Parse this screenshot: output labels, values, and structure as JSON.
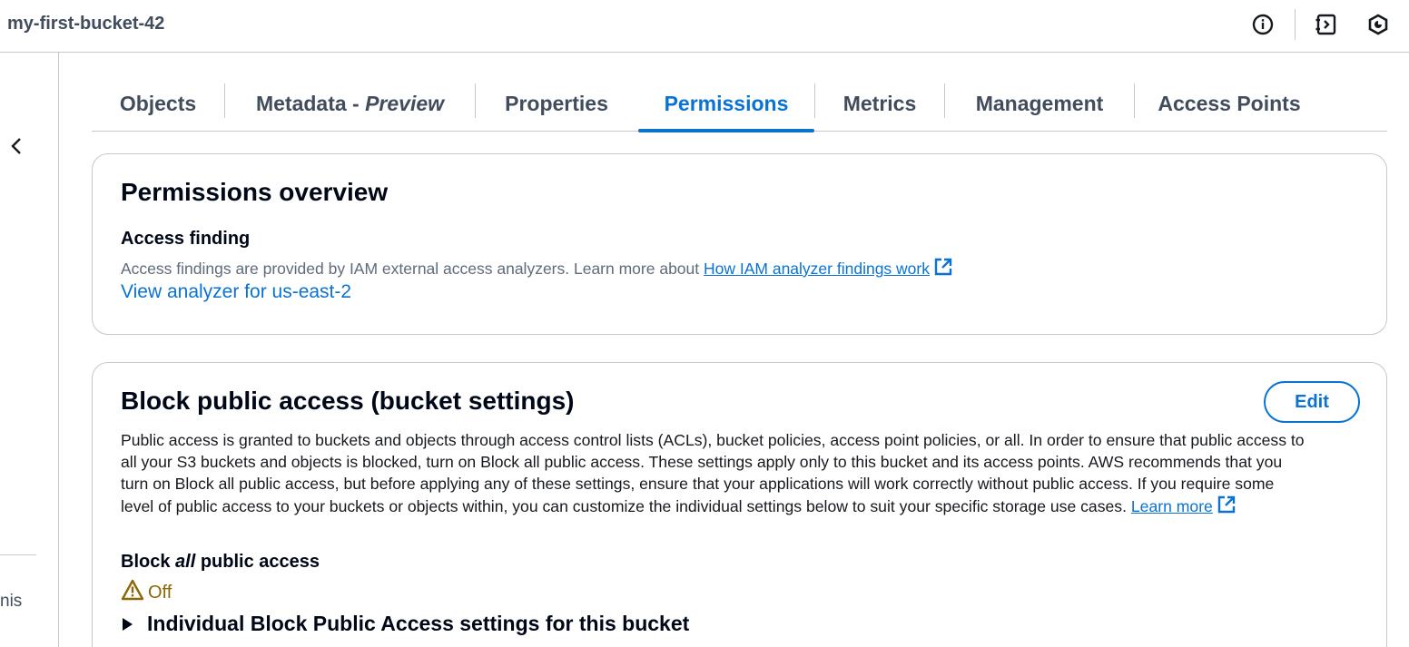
{
  "header": {
    "bucket_name": "my-first-bucket-42",
    "icons": [
      "info-icon",
      "notes-panel-icon",
      "security-shield-icon"
    ]
  },
  "sidebar": {
    "peek_text": "nis"
  },
  "tabs": [
    {
      "label": "Objects"
    },
    {
      "label": "Metadata - ",
      "label_italic": "Preview"
    },
    {
      "label": "Properties"
    },
    {
      "label": "Permissions",
      "active": true
    },
    {
      "label": "Metrics"
    },
    {
      "label": "Management"
    },
    {
      "label": "Access Points"
    }
  ],
  "overview": {
    "title": "Permissions overview",
    "access_finding_label": "Access finding",
    "description": "Access findings are provided by IAM external access analyzers. Learn more about ",
    "link_text": "How IAM analyzer findings work",
    "analyzer_link": "View analyzer for us-east-2"
  },
  "block_public_access": {
    "title": "Block public access (bucket settings)",
    "edit_label": "Edit",
    "description_lines": [
      "Public access is granted to buckets and objects through access control lists (ACLs), bucket policies, access point policies, or all. In order to ensure that public access to",
      "all your S3 buckets and objects is blocked, turn on Block all public access. These settings apply only to this bucket and its access points. AWS recommends that you",
      "turn on Block all public access, but before applying any of these settings, ensure that your applications will work correctly without public access. If you require some",
      "level of public access to your buckets or objects within, you can customize the individual settings below to suit your specific storage use cases. "
    ],
    "learn_more": "Learn more",
    "setting_label_prefix": "Block ",
    "setting_label_italic": "all",
    "setting_label_suffix": " public access",
    "status_text": "Off",
    "status_color": "#8d6605",
    "expander_label": "Individual Block Public Access settings for this bucket"
  },
  "colors": {
    "accent": "#0972d3",
    "border": "#c6c6cd",
    "warning": "#8d6605"
  }
}
